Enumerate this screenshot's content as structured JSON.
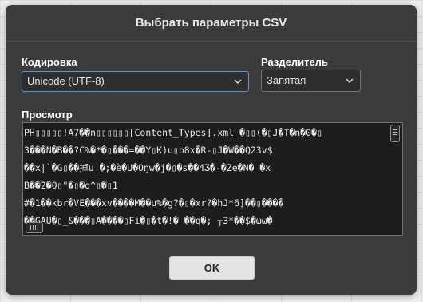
{
  "dialog": {
    "title": "Выбрать параметры CSV",
    "ok_label": "OK"
  },
  "encoding": {
    "label": "Кодировка",
    "value": "Unicode (UTF-8)"
  },
  "delimiter": {
    "label": "Разделитель",
    "value": "Запятая"
  },
  "preview": {
    "label": "Просмотр",
    "lines": [
      "PH▯▯▯▯▯!A7��n▯▯▯▯▯▯[Content_Types].xml �▯▯(�▯J�T�n�0�▯",
      "3���N�B��?C%�*�▯���=��Y▯K)u▯b8x�R-▯J�W��Q23v$",
      "��x|`�G▯��掉u_�;�è�U�Oŋw�j�▯�s��4Ʒ�-�Ze�N� �x",
      "B��2�0▯\"�▯�q^▯�▯1",
      "#�1��kbr�VE���xv����M��u%�g?�▯�xr?�hJ*6]��▯����",
      "��GAU�▯_&���▯A����▯Fi�▯�t�!� ��q�; ┬3*��$�ωω�"
    ]
  }
}
